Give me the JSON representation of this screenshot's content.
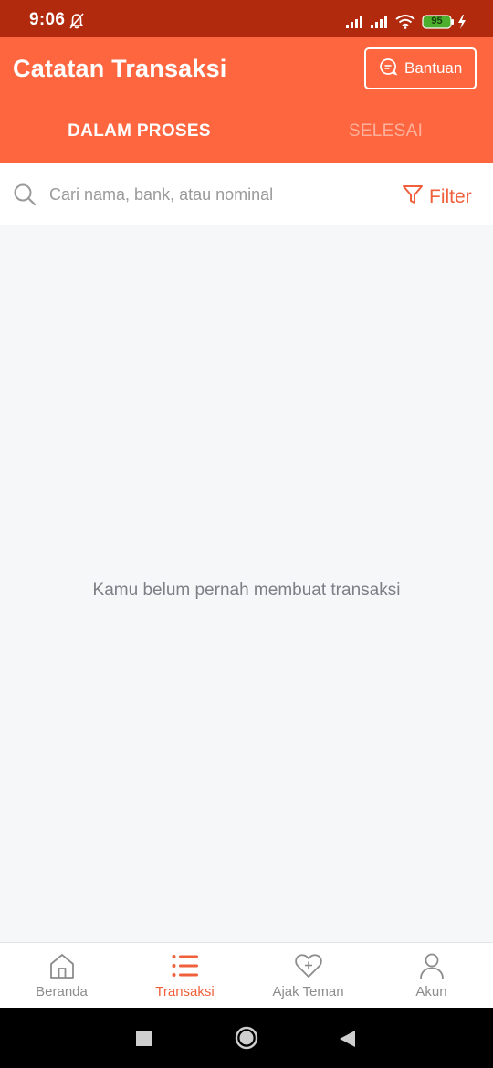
{
  "status_bar": {
    "time": "9:06",
    "battery": "95",
    "icons": [
      "bell-muted-icon",
      "signal-icon",
      "signal-icon",
      "wifi-icon",
      "battery-icon",
      "charging-icon"
    ]
  },
  "header": {
    "title": "Catatan Transaksi",
    "help_label": "Bantuan",
    "tabs": [
      {
        "label": "DALAM PROSES",
        "active": true
      },
      {
        "label": "SELESAI",
        "active": false
      }
    ]
  },
  "search": {
    "placeholder": "Cari nama, bank, atau nominal",
    "value": "",
    "filter_label": "Filter"
  },
  "content": {
    "empty_message": "Kamu belum pernah membuat transaksi"
  },
  "bottom_nav": {
    "items": [
      {
        "label": "Beranda",
        "icon": "home-icon",
        "active": false
      },
      {
        "label": "Transaksi",
        "icon": "list-icon",
        "active": true
      },
      {
        "label": "Ajak Teman",
        "icon": "heart-plus-icon",
        "active": false
      },
      {
        "label": "Akun",
        "icon": "user-icon",
        "active": false
      }
    ]
  },
  "colors": {
    "brand": "#fe6640",
    "status_bar": "#b22a0e",
    "accent_text": "#f0603c",
    "inactive_text": "#8c8c8c",
    "background": "#f6f7f9"
  }
}
